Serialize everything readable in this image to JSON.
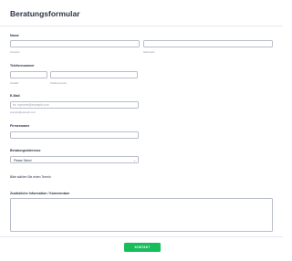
{
  "form": {
    "title": "Beratungsformular",
    "name": {
      "label": "Name",
      "first_sub": "Vorname",
      "last_sub": "Nachname"
    },
    "phone": {
      "label": "Telefonnummer",
      "area_sub": "Vorwahl",
      "number_sub": "Telefonnummer"
    },
    "email": {
      "label": "E-Mail",
      "placeholder": "ex: myname@example.com",
      "sub": "example@example.com"
    },
    "company": {
      "label": "Firmenname"
    },
    "interest": {
      "label": "Beratungsinteresse",
      "selected": "Please Select"
    },
    "appointment_text": "Bitte wählen Sie einen Termin",
    "info": {
      "label": "Zusätzliche Information / Kommentare"
    },
    "submit_label": "KONTAKT"
  },
  "colors": {
    "submit": "#18bd5b",
    "text": "#2c3345"
  }
}
